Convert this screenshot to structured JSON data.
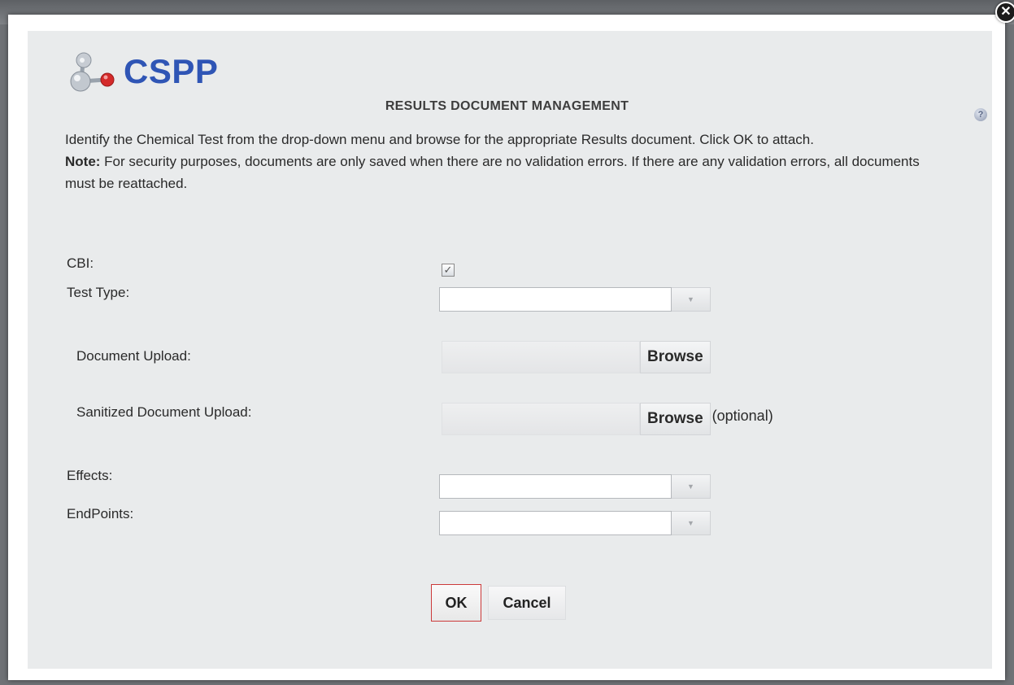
{
  "app": {
    "logo_text": "CSPP",
    "brand_color": "#2f55b5"
  },
  "dialog": {
    "title": "RESULTS DOCUMENT MANAGEMENT",
    "close_icon": "close-icon",
    "help_icon": "help-icon",
    "instruction_line": "Identify the Chemical Test from the drop-down menu and browse for the appropriate Results document. Click OK to attach.",
    "note_label": "Note:",
    "note_text": " For security purposes, documents are only saved when there are no validation errors. If there are any validation errors, all documents must be reattached."
  },
  "form": {
    "cbi_label": "CBI:",
    "cbi_checked": true,
    "cbi_check_glyph": "✓",
    "test_type_label": "Test Type:",
    "test_type_value": "",
    "document_upload_label": "Document Upload:",
    "document_upload_value": "",
    "sanitized_upload_label": "Sanitized Document Upload:",
    "sanitized_upload_value": "",
    "browse_label": "Browse",
    "optional_label": "(optional)",
    "effects_label": "Effects:",
    "effects_value": "",
    "endpoints_label": "EndPoints:",
    "endpoints_value": "",
    "dropdown_arrow_glyph": "▼"
  },
  "actions": {
    "ok_label": "OK",
    "cancel_label": "Cancel",
    "ok_border_color": "#cc3a3a"
  }
}
